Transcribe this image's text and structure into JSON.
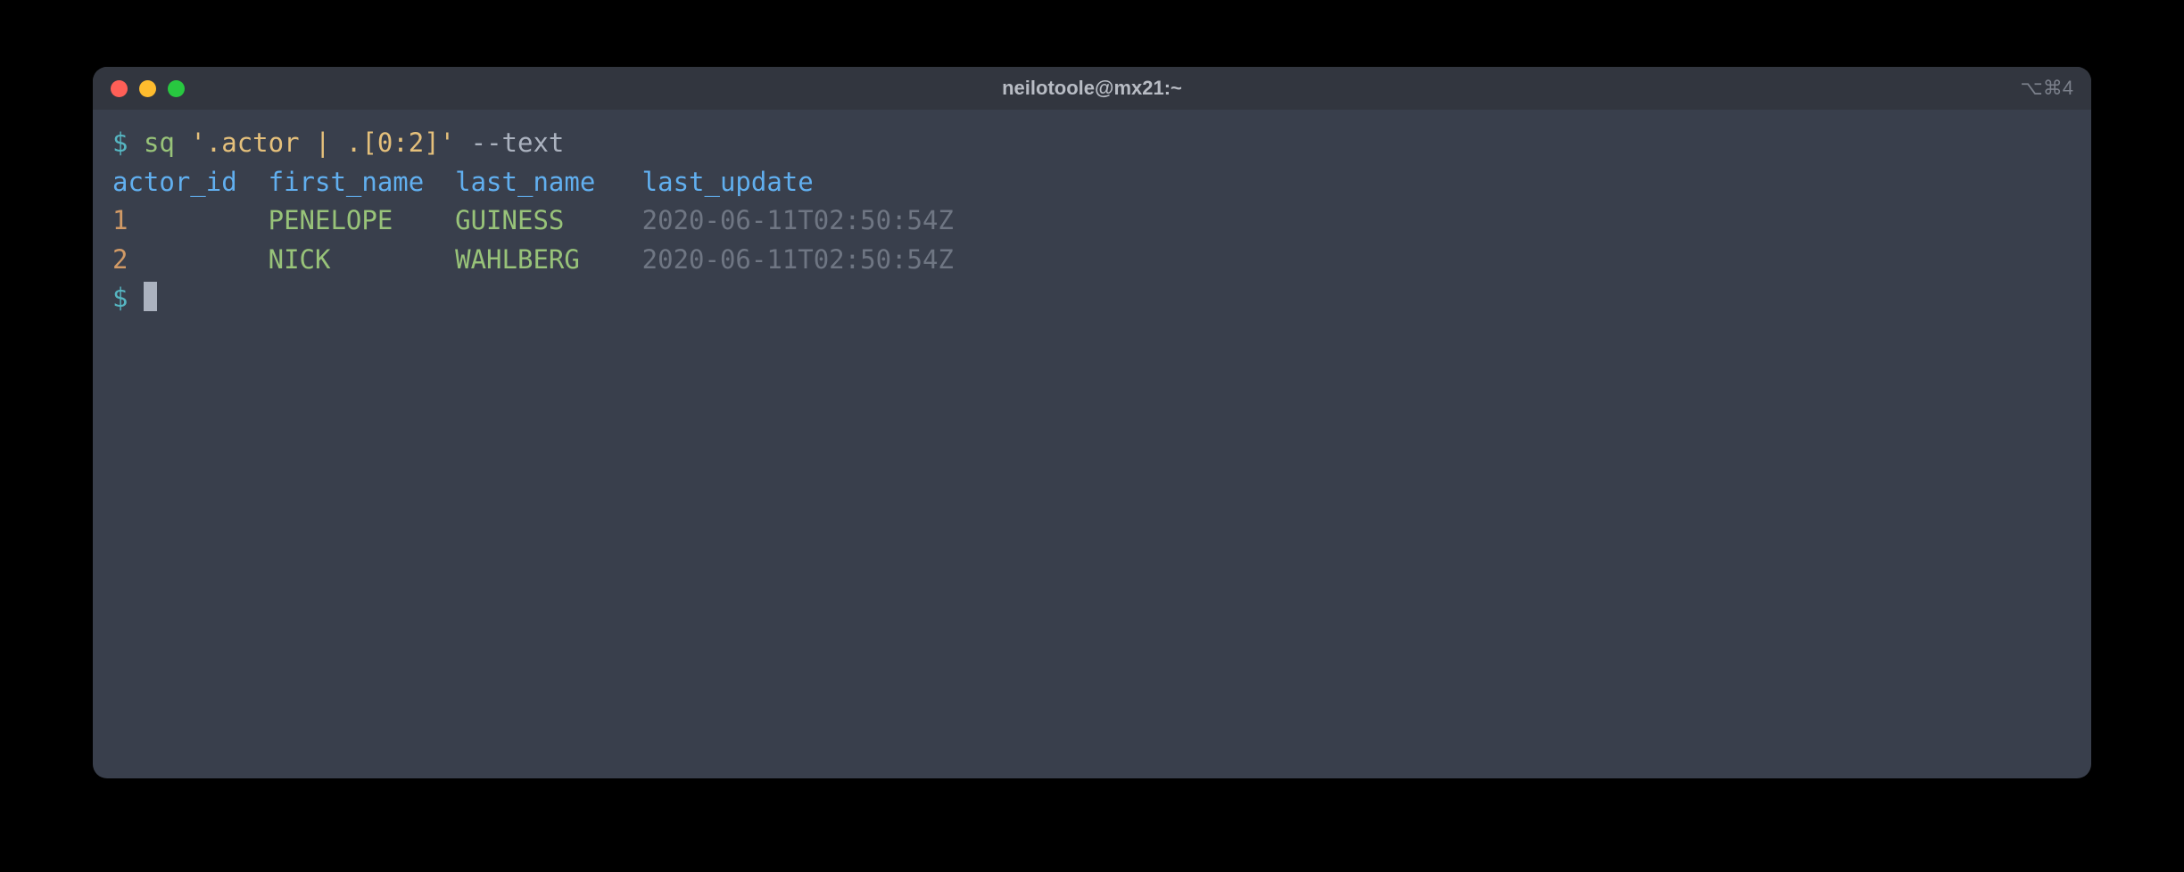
{
  "window": {
    "title": "neilotoole@mx21:~",
    "right_indicator": "⌥⌘4"
  },
  "prompt": "$",
  "command": {
    "executable": "sq",
    "argument": "'.actor | .[0:2]'",
    "flag": "--text"
  },
  "table": {
    "headers": {
      "col1": "actor_id",
      "col2": "first_name",
      "col3": "last_name",
      "col4": "last_update"
    },
    "rows": [
      {
        "actor_id": "1",
        "first_name": "PENELOPE",
        "last_name": "GUINESS",
        "last_update": "2020-06-11T02:50:54Z"
      },
      {
        "actor_id": "2",
        "first_name": "NICK",
        "last_name": "WAHLBERG",
        "last_update": "2020-06-11T02:50:54Z"
      }
    ]
  }
}
